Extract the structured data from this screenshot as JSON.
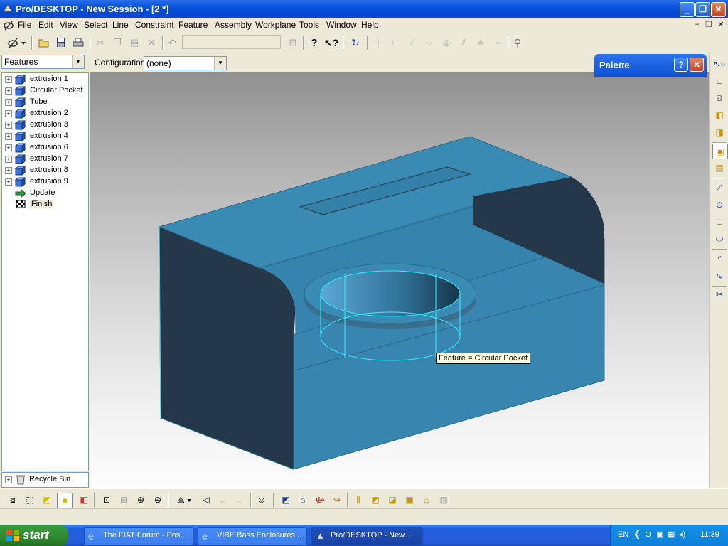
{
  "window": {
    "title": "Pro/DESKTOP - New Session - [2 *]"
  },
  "menubar": {
    "items": [
      "File",
      "Edit",
      "View",
      "Select",
      "Line",
      "Constraint",
      "Feature",
      "Assembly",
      "Workplane",
      "Tools",
      "Window",
      "Help"
    ]
  },
  "left_panel": {
    "selector": "Features",
    "tree": [
      {
        "label": "extrusion 1",
        "kind": "feature"
      },
      {
        "label": "Circular Pocket",
        "kind": "feature"
      },
      {
        "label": "Tube",
        "kind": "feature"
      },
      {
        "label": "extrusion 2",
        "kind": "feature"
      },
      {
        "label": "extrusion 3",
        "kind": "feature"
      },
      {
        "label": "extrusion 4",
        "kind": "feature"
      },
      {
        "label": "extrusion 6",
        "kind": "feature"
      },
      {
        "label": "extrusion 7",
        "kind": "feature"
      },
      {
        "label": "extrusion 8",
        "kind": "feature"
      },
      {
        "label": "extrusion 9",
        "kind": "feature"
      },
      {
        "label": "Update",
        "kind": "update"
      },
      {
        "label": "Finish",
        "kind": "finish"
      }
    ],
    "recycle_bin": "Recycle Bin"
  },
  "config": {
    "label": "Configuration:",
    "value": "(none)"
  },
  "palette": {
    "title": "Palette"
  },
  "viewport": {
    "tooltip": "Feature = Circular Pocket",
    "model_color": "#3a8bb4"
  },
  "taskbar": {
    "start": "start",
    "tasks": [
      {
        "label": "The FIAT Forum - Pos...",
        "icon": "ie-icon",
        "active": false
      },
      {
        "label": "VIBE Bass Enclosures ...",
        "icon": "ie-icon",
        "active": false
      },
      {
        "label": "Pro/DESKTOP - New ...",
        "icon": "prodesktop-icon",
        "active": true
      }
    ],
    "lang": "EN",
    "clock": "11:39"
  }
}
